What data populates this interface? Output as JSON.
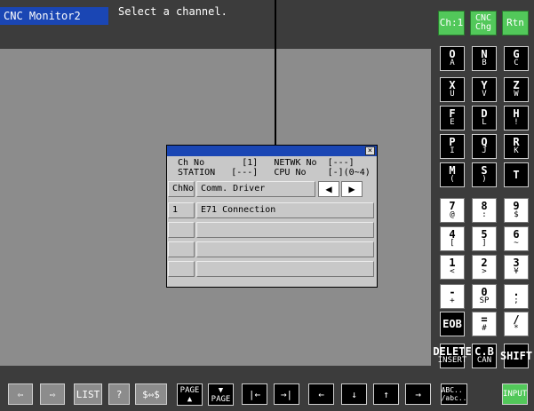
{
  "header": {
    "title": "CNC Monitor2",
    "message": "Select a channel."
  },
  "top_buttons": [
    {
      "label": "Ch:1"
    },
    {
      "label": "CNC\nChg"
    },
    {
      "label": "Rtn"
    }
  ],
  "keys": [
    {
      "main": "O",
      "sub": "A"
    },
    {
      "main": "N",
      "sub": "B"
    },
    {
      "main": "G",
      "sub": "C"
    },
    {
      "main": "X",
      "sub": "U"
    },
    {
      "main": "Y",
      "sub": "V"
    },
    {
      "main": "Z",
      "sub": "W"
    },
    {
      "main": "F",
      "sub": "E"
    },
    {
      "main": "D",
      "sub": "L"
    },
    {
      "main": "H",
      "sub": "!"
    },
    {
      "main": "P",
      "sub": "I"
    },
    {
      "main": "Q",
      "sub": "J"
    },
    {
      "main": "R",
      "sub": "K"
    },
    {
      "main": "M",
      "sub": "("
    },
    {
      "main": "S",
      "sub": ")"
    },
    {
      "main": "T",
      "sub": ""
    },
    {
      "main": "7",
      "sub": "@"
    },
    {
      "main": "8",
      "sub": ":"
    },
    {
      "main": "9",
      "sub": "$"
    },
    {
      "main": "4",
      "sub": "["
    },
    {
      "main": "5",
      "sub": "]"
    },
    {
      "main": "6",
      "sub": "~"
    },
    {
      "main": "1",
      "sub": "<"
    },
    {
      "main": "2",
      "sub": ">"
    },
    {
      "main": "3",
      "sub": "¥"
    },
    {
      "main": "-",
      "sub": "+"
    },
    {
      "main": "0",
      "sub": "SP"
    },
    {
      "main": ".",
      "sub": ";"
    },
    {
      "main": "EOB",
      "sub": ""
    },
    {
      "main": "=",
      "sub": "#"
    },
    {
      "main": "/",
      "sub": "*"
    },
    {
      "main": "DELETE",
      "sub": "INSERT"
    },
    {
      "main": "C.B",
      "sub": "CAN"
    },
    {
      "main": "SHIFT",
      "sub": ""
    }
  ],
  "bottom": [
    {
      "label": "⇦"
    },
    {
      "label": "⇨"
    },
    {
      "label": "LIST"
    },
    {
      "label": "?"
    },
    {
      "label": "$⇔$"
    },
    {
      "label": "PAGE ▲"
    },
    {
      "label": "▼ PAGE"
    },
    {
      "label": "|←"
    },
    {
      "label": "→|"
    },
    {
      "label": "←"
    },
    {
      "label": "↓"
    },
    {
      "label": "↑"
    },
    {
      "label": "→"
    },
    {
      "label": "ABC.. /abc.."
    },
    {
      "label": "INPUT"
    }
  ],
  "dialog": {
    "line1": "Ch No       [1]   NETWK No  [---]",
    "line2": "STATION   [---]   CPU No    [-](0~4)",
    "header_no": "ChNo",
    "header_driver": "Comm. Driver",
    "prev": "◀",
    "next": "▶",
    "rows": [
      {
        "no": "1",
        "driver": "E71 Connection"
      },
      {
        "no": "",
        "driver": ""
      },
      {
        "no": "",
        "driver": ""
      },
      {
        "no": "",
        "driver": ""
      }
    ],
    "close": "×"
  }
}
